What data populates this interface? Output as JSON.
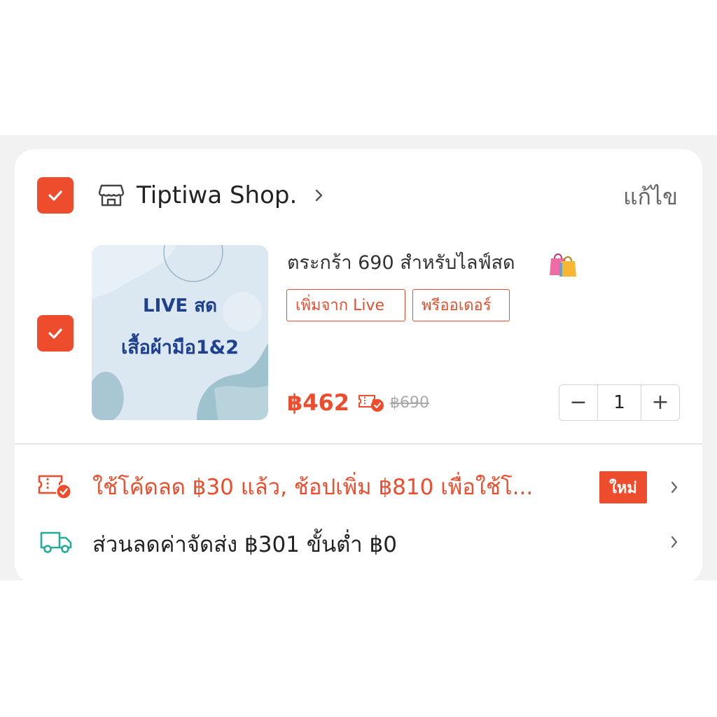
{
  "shop": {
    "name": "Tiptiwa Shop.",
    "edit_label": "แก้ไข",
    "selected": true
  },
  "item": {
    "selected": true,
    "thumbnail": {
      "line1": "LIVE สด",
      "line2": "เสื้อผ้ามือ1&2"
    },
    "title": "ตระกร้า 690 สำหรับไลฟ์สด",
    "tags": [
      "เพิ่มจาก Live",
      "พรีออเดอร์"
    ],
    "price": "฿462",
    "original_price": "฿690",
    "quantity": "1",
    "decrease_label": "−",
    "increase_label": "+"
  },
  "promo": {
    "text": "ใช้โค้ดลด ฿30 แล้ว, ช้อปเพิ่ม ฿810 เพื่อใช้โ...",
    "badge": "ใหม่"
  },
  "shipping": {
    "text": "ส่วนลดค่าจัดส่ง ฿301 ขั้นต่ำ ฿0"
  },
  "colors": {
    "accent": "#ee4d2d",
    "shipping_icon": "#26aa99",
    "background_band": "#f2f2f2"
  },
  "icons": [
    "checkbox-checked-icon",
    "store-icon",
    "chevron-right-icon",
    "shopping-bags-icon",
    "voucher-check-icon",
    "delivery-truck-icon"
  ]
}
